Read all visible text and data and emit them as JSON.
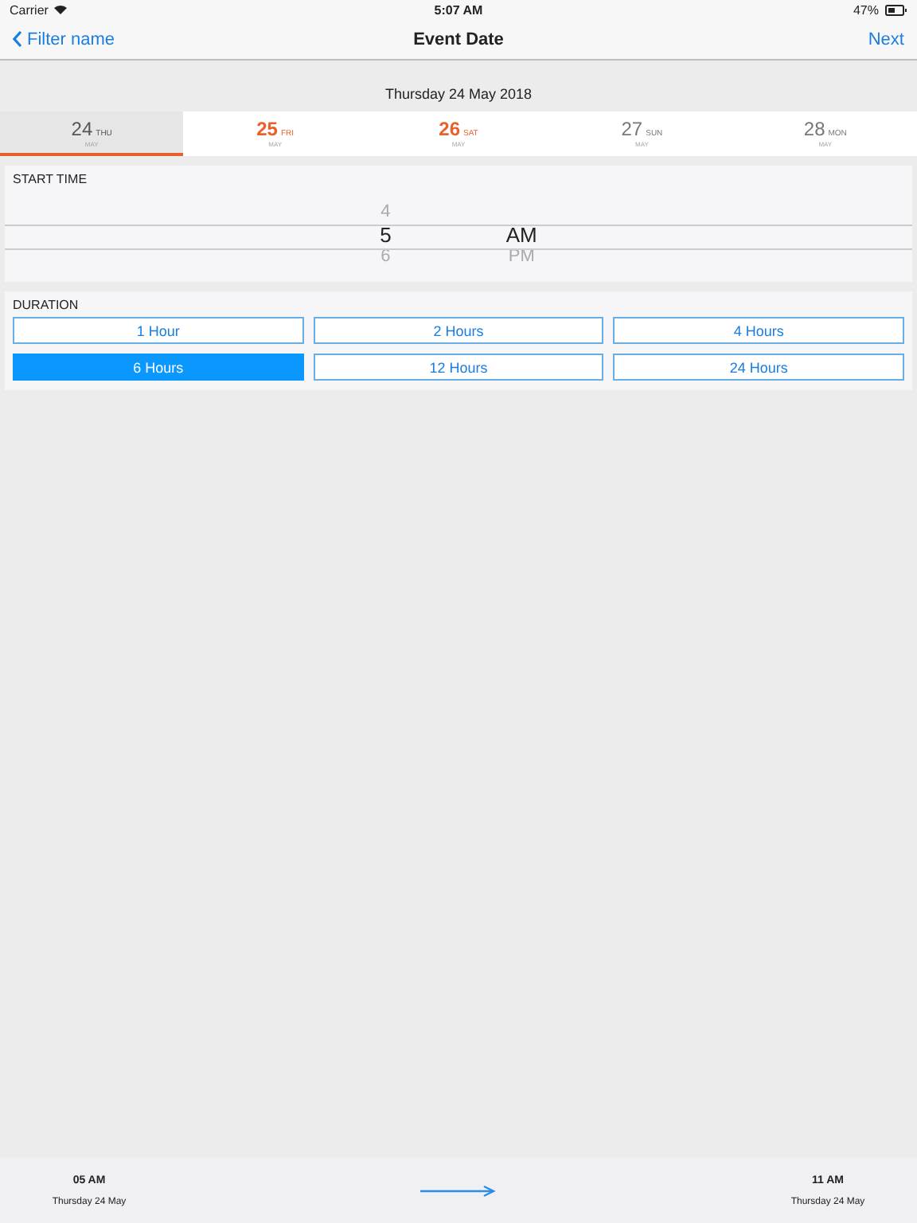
{
  "status_bar": {
    "carrier": "Carrier",
    "time": "5:07 AM",
    "battery": "47%"
  },
  "nav": {
    "back": "Filter name",
    "title": "Event Date",
    "next": "Next"
  },
  "date_label": "Thursday 24 May 2018",
  "days": [
    {
      "day": "24",
      "weekday": "THU",
      "month": "MAY",
      "selected": true,
      "color": "#555555"
    },
    {
      "day": "25",
      "weekday": "FRI",
      "month": "MAY",
      "selected": false,
      "color": "#e8612c"
    },
    {
      "day": "26",
      "weekday": "SAT",
      "month": "MAY",
      "selected": false,
      "color": "#e8612c"
    },
    {
      "day": "27",
      "weekday": "SUN",
      "month": "MAY",
      "selected": false,
      "color": "#777777"
    },
    {
      "day": "28",
      "weekday": "MON",
      "month": "MAY",
      "selected": false,
      "color": "#777777"
    }
  ],
  "start_time": {
    "title": "START TIME",
    "hours": [
      {
        "label": "4",
        "selected": false
      },
      {
        "label": "5",
        "selected": true
      },
      {
        "label": "6",
        "selected": false
      }
    ],
    "periods": [
      {
        "label": "AM",
        "selected": true
      },
      {
        "label": "PM",
        "selected": false
      }
    ]
  },
  "duration": {
    "title": "DURATION",
    "options": [
      {
        "label": "1 Hour",
        "selected": false
      },
      {
        "label": "2 Hours",
        "selected": false
      },
      {
        "label": "4 Hours",
        "selected": false
      },
      {
        "label": "6 Hours",
        "selected": true
      },
      {
        "label": "12 Hours",
        "selected": false
      },
      {
        "label": "24 Hours",
        "selected": false
      }
    ]
  },
  "footer": {
    "start_time": "05 AM",
    "start_date": "Thursday 24 May",
    "end_time": "11 AM",
    "end_date": "Thursday 24 May"
  }
}
